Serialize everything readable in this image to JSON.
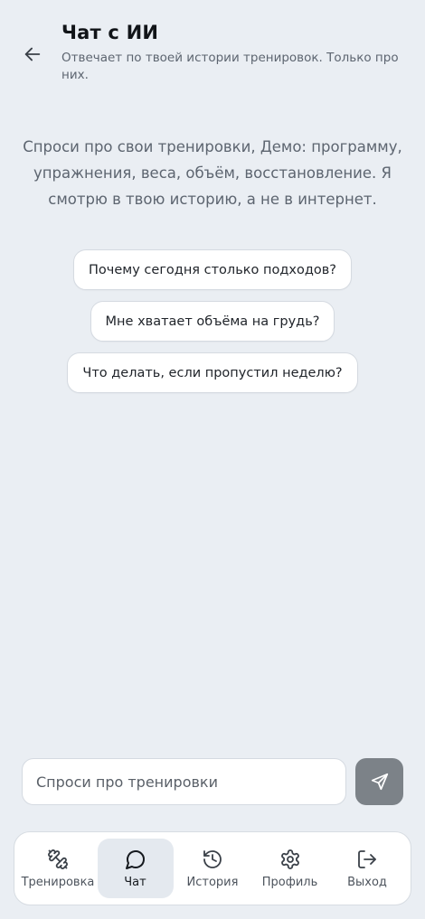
{
  "header": {
    "title": "Чат с ИИ",
    "subtitle": "Отвечает по твоей истории тренировок. Только про них."
  },
  "intro": {
    "text": "Спроси про свои тренировки, Демо: программу, упражнения, веса, объём, восстановление. Я смотрю в твою историю, а не в интернет."
  },
  "suggestions": [
    "Почему сегодня столько подходов?",
    "Мне хватает объёма на грудь?",
    "Что делать, если пропустил неделю?"
  ],
  "composer": {
    "placeholder": "Спроси про тренировки",
    "value": "",
    "send_icon": "send-icon"
  },
  "nav": {
    "active": "chat",
    "items": [
      {
        "id": "workout",
        "label": "Тренировка",
        "icon": "dumbbell-icon"
      },
      {
        "id": "chat",
        "label": "Чат",
        "icon": "chat-bubble-icon"
      },
      {
        "id": "history",
        "label": "История",
        "icon": "history-icon"
      },
      {
        "id": "profile",
        "label": "Профиль",
        "icon": "gear-icon"
      },
      {
        "id": "logout",
        "label": "Выход",
        "icon": "logout-icon"
      }
    ]
  },
  "colors": {
    "background": "#eaeef3",
    "send_button": "#7c8288",
    "active_nav_bg": "#e4e9ef"
  }
}
